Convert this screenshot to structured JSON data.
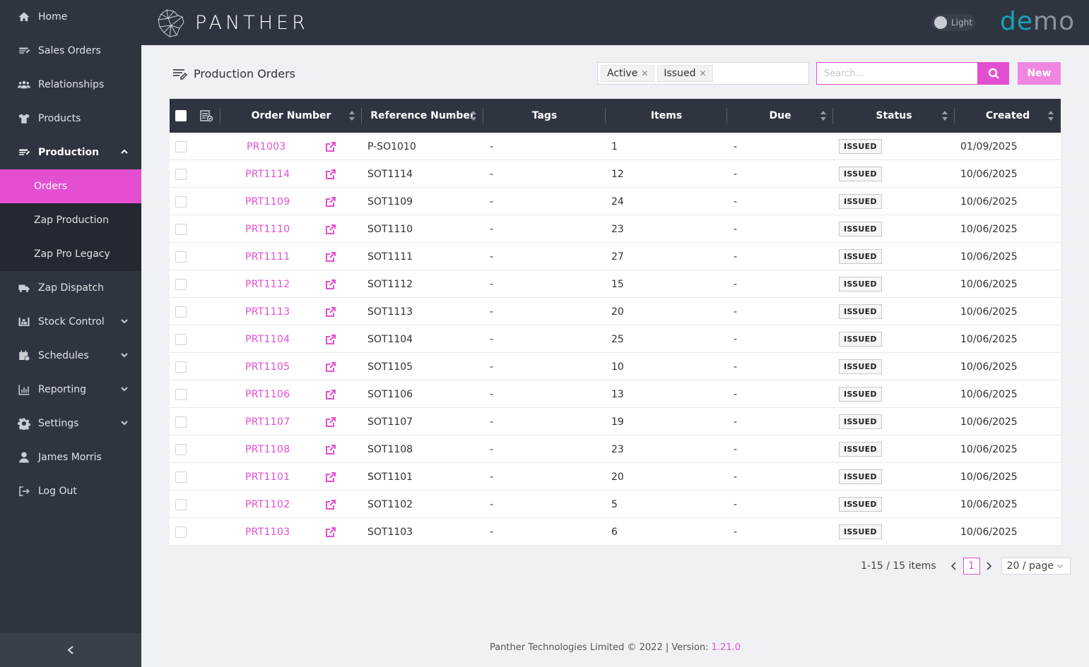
{
  "sidebar": {
    "items": [
      {
        "label": "Home",
        "icon": "home-icon"
      },
      {
        "label": "Sales Orders",
        "icon": "sales-orders-icon"
      },
      {
        "label": "Relationships",
        "icon": "users-icon"
      },
      {
        "label": "Products",
        "icon": "shirt-icon"
      },
      {
        "label": "Production",
        "icon": "production-icon"
      },
      {
        "label": "Zap Dispatch",
        "icon": "truck-icon"
      },
      {
        "label": "Stock Control",
        "icon": "warehouse-icon"
      },
      {
        "label": "Schedules",
        "icon": "calendar-icon"
      },
      {
        "label": "Reporting",
        "icon": "chart-icon"
      },
      {
        "label": "Settings",
        "icon": "gear-icon"
      },
      {
        "label": "James Morris",
        "icon": "user-icon"
      },
      {
        "label": "Log Out",
        "icon": "logout-icon"
      }
    ],
    "production_sub": [
      {
        "label": "Orders"
      },
      {
        "label": "Zap Production"
      },
      {
        "label": "Zap Pro Legacy"
      }
    ]
  },
  "header": {
    "logo_text": "PANTHER",
    "theme_label": "Light",
    "brand_a": "de",
    "brand_b": "mo"
  },
  "page": {
    "title": "Production Orders",
    "filters": [
      "Active",
      "Issued"
    ],
    "search_placeholder": "Search...",
    "new_label": "New"
  },
  "table": {
    "columns": {
      "order_number": "Order Number",
      "reference_number": "Reference Number",
      "tags": "Tags",
      "items": "Items",
      "due": "Due",
      "status": "Status",
      "created": "Created"
    },
    "rows": [
      {
        "order": "PR1003",
        "ref": "P-SO1010",
        "tags": "-",
        "items": "1",
        "due": "-",
        "status": "ISSUED",
        "created": "01/09/2025"
      },
      {
        "order": "PRT1114",
        "ref": "SOT1114",
        "tags": "-",
        "items": "12",
        "due": "-",
        "status": "ISSUED",
        "created": "10/06/2025"
      },
      {
        "order": "PRT1109",
        "ref": "SOT1109",
        "tags": "-",
        "items": "24",
        "due": "-",
        "status": "ISSUED",
        "created": "10/06/2025"
      },
      {
        "order": "PRT1110",
        "ref": "SOT1110",
        "tags": "-",
        "items": "23",
        "due": "-",
        "status": "ISSUED",
        "created": "10/06/2025"
      },
      {
        "order": "PRT1111",
        "ref": "SOT1111",
        "tags": "-",
        "items": "27",
        "due": "-",
        "status": "ISSUED",
        "created": "10/06/2025"
      },
      {
        "order": "PRT1112",
        "ref": "SOT1112",
        "tags": "-",
        "items": "15",
        "due": "-",
        "status": "ISSUED",
        "created": "10/06/2025"
      },
      {
        "order": "PRT1113",
        "ref": "SOT1113",
        "tags": "-",
        "items": "20",
        "due": "-",
        "status": "ISSUED",
        "created": "10/06/2025"
      },
      {
        "order": "PRT1104",
        "ref": "SOT1104",
        "tags": "-",
        "items": "25",
        "due": "-",
        "status": "ISSUED",
        "created": "10/06/2025"
      },
      {
        "order": "PRT1105",
        "ref": "SOT1105",
        "tags": "-",
        "items": "10",
        "due": "-",
        "status": "ISSUED",
        "created": "10/06/2025"
      },
      {
        "order": "PRT1106",
        "ref": "SOT1106",
        "tags": "-",
        "items": "13",
        "due": "-",
        "status": "ISSUED",
        "created": "10/06/2025"
      },
      {
        "order": "PRT1107",
        "ref": "SOT1107",
        "tags": "-",
        "items": "19",
        "due": "-",
        "status": "ISSUED",
        "created": "10/06/2025"
      },
      {
        "order": "PRT1108",
        "ref": "SOT1108",
        "tags": "-",
        "items": "23",
        "due": "-",
        "status": "ISSUED",
        "created": "10/06/2025"
      },
      {
        "order": "PRT1101",
        "ref": "SOT1101",
        "tags": "-",
        "items": "20",
        "due": "-",
        "status": "ISSUED",
        "created": "10/06/2025"
      },
      {
        "order": "PRT1102",
        "ref": "SOT1102",
        "tags": "-",
        "items": "5",
        "due": "-",
        "status": "ISSUED",
        "created": "10/06/2025"
      },
      {
        "order": "PRT1103",
        "ref": "SOT1103",
        "tags": "-",
        "items": "6",
        "due": "-",
        "status": "ISSUED",
        "created": "10/06/2025"
      }
    ]
  },
  "pagination": {
    "total": "1-15 / 15 items",
    "current_page": "1",
    "page_size": "20 / page"
  },
  "footer": {
    "text": "Panther Technologies Limited © 2022 | Version: ",
    "version": "1.21.0"
  },
  "colors": {
    "accent": "#e44fd1",
    "sidebar_bg": "#2f3540",
    "brand": "#17a1b6"
  }
}
